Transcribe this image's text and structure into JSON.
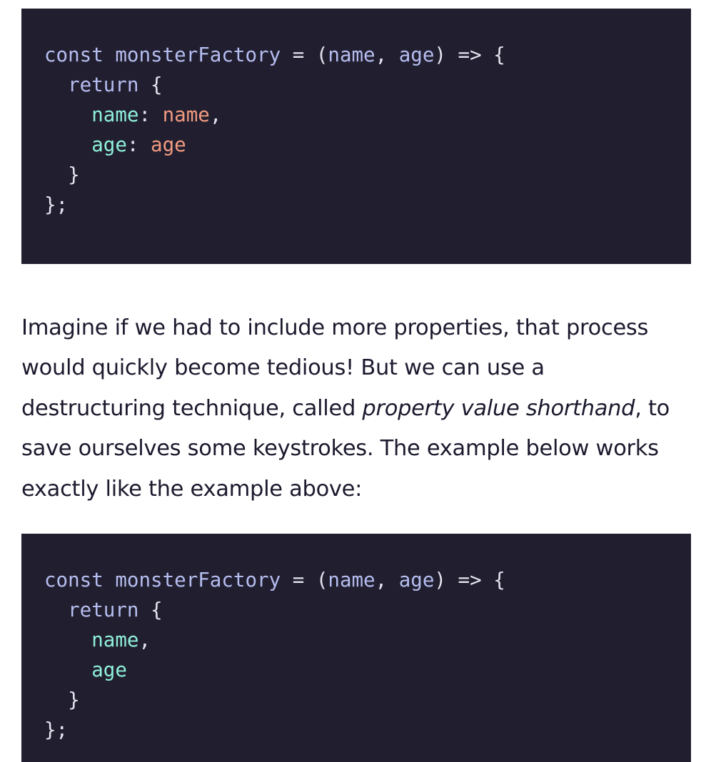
{
  "code_block_1": {
    "line1": {
      "kw": "const",
      "fn": "monsterFactory",
      "op": " = ",
      "open": "(",
      "p1": "name",
      "comma": ", ",
      "p2": "age",
      "close": ")",
      "arrow": " => {"
    },
    "line2": {
      "kw": "return",
      "brace": " {"
    },
    "line3": {
      "key": "name",
      "sep": ": ",
      "val": "name",
      "end": ","
    },
    "line4": {
      "key": "age",
      "sep": ": ",
      "val": "age"
    },
    "line5": "}",
    "line6": "};"
  },
  "paragraph": {
    "line1": "Imagine if we had to include more properties, that process",
    "line2": "would quickly become tedious! But we can use a",
    "line3_before": "destructuring technique, called ",
    "line3_em": "property value shorthand",
    "line3_after": ", to",
    "line4": "save ourselves some keystrokes. The example below works",
    "line5": "exactly like the example above:"
  },
  "code_block_2": {
    "line1": {
      "kw": "const",
      "fn": "monsterFactory",
      "op": " = ",
      "open": "(",
      "p1": "name",
      "comma": ", ",
      "p2": "age",
      "close": ")",
      "arrow": " => {"
    },
    "line2": {
      "kw": "return",
      "brace": " {"
    },
    "line3": {
      "key": "name",
      "end": ","
    },
    "line4": {
      "key": "age"
    },
    "line5": "}",
    "line6": "};"
  },
  "colors": {
    "code_background": "#211f2f",
    "keyword": "#b6bdf0",
    "object_key": "#8ff0da",
    "object_value": "#f29a80",
    "text": "#1b1a2e"
  }
}
